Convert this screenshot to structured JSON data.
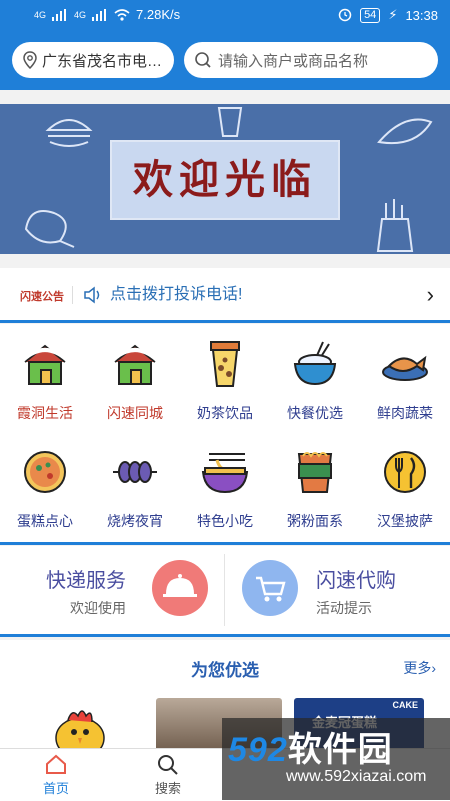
{
  "statusbar": {
    "signal_a": "4G",
    "signal_b": "4G",
    "speed": "7.28K/s",
    "battery": "54",
    "time": "13:38"
  },
  "search": {
    "location": "广东省茂名市电…",
    "placeholder": "请输入商户或商品名称"
  },
  "banner": {
    "text": "欢迎光临"
  },
  "notice": {
    "tag": "闪速公告",
    "text": "点击拨打投诉电话!"
  },
  "categories": [
    {
      "label": "霞洞生活",
      "icon": "house-icon",
      "color": "#c0392b"
    },
    {
      "label": "闪速同城",
      "icon": "house-icon",
      "color": "#c0392b"
    },
    {
      "label": "奶茶饮品",
      "icon": "milk-tea-icon",
      "color": "#2f3e8f"
    },
    {
      "label": "快餐优选",
      "icon": "rice-bowl-icon",
      "color": "#2f3e8f"
    },
    {
      "label": "鲜肉蔬菜",
      "icon": "fish-plate-icon",
      "color": "#2f3e8f"
    },
    {
      "label": "蛋糕点心",
      "icon": "pizza-icon",
      "color": "#2f3e8f"
    },
    {
      "label": "烧烤夜宵",
      "icon": "skewer-icon",
      "color": "#2f3e8f"
    },
    {
      "label": "特色小吃",
      "icon": "noodle-bowl-icon",
      "color": "#2f3e8f"
    },
    {
      "label": "粥粉面系",
      "icon": "noodle-cup-icon",
      "color": "#2f3e8f"
    },
    {
      "label": "汉堡披萨",
      "icon": "fork-knife-icon",
      "color": "#2f3e8f"
    }
  ],
  "services": [
    {
      "title": "快递服务",
      "subtitle": "欢迎使用",
      "icon": "cloche-icon",
      "color": "#f07a78"
    },
    {
      "title": "闪速代购",
      "subtitle": "活动提示",
      "icon": "cart-icon",
      "color": "#8fb6ef"
    }
  ],
  "recommend": {
    "title": "为您优选",
    "more": "更多",
    "thumb3_text": "金麦冠蛋糕",
    "thumb3_tag": "CAKE"
  },
  "tabbar": [
    {
      "label": "首页",
      "icon": "home-icon",
      "active": true
    },
    {
      "label": "搜索",
      "icon": "search-icon",
      "active": false
    }
  ],
  "watermark": {
    "brand_num": "592",
    "brand_text": "软件园",
    "url": "www.592xiazai.com"
  }
}
